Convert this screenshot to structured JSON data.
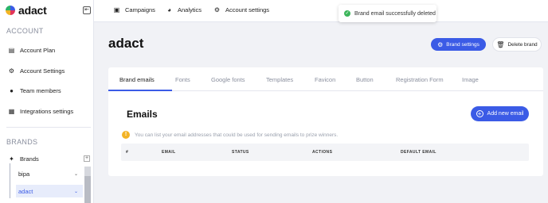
{
  "app": {
    "logo_text": "adact"
  },
  "sidebar": {
    "collapse_icon": "collapse-left-icon",
    "account_title": "ACCOUNT",
    "account_items": [
      {
        "label": "Account Plan",
        "icon": "document-icon"
      },
      {
        "label": "Account Settings",
        "icon": "gear-icon"
      },
      {
        "label": "Team members",
        "icon": "users-icon"
      },
      {
        "label": "Integrations settings",
        "icon": "grid-icon"
      }
    ],
    "brands_title": "BRANDS",
    "brands_root": "Brands",
    "brands": [
      {
        "label": "bipa"
      },
      {
        "label": "adact",
        "active": true
      }
    ]
  },
  "topbar": {
    "items": [
      {
        "label": "Campaigns",
        "icon": "calendar-icon"
      },
      {
        "label": "Analytics",
        "icon": "pie-chart-icon"
      },
      {
        "label": "Account settings",
        "icon": "gear-icon"
      }
    ]
  },
  "toast": {
    "message": "Brand email successfully deleted"
  },
  "page": {
    "title": "adact",
    "brand_settings_label": "Brand settings",
    "delete_brand_label": "Delete brand"
  },
  "tabs": [
    "Brand emails",
    "Fonts",
    "Google fonts",
    "Templates",
    "Favicon",
    "Button",
    "Registration Form",
    "Image"
  ],
  "emails": {
    "title": "Emails",
    "add_label": "Add new email",
    "info": "You can list your email addresses that could be used for sending emails to prize winners.",
    "columns": [
      "#",
      "EMAIL",
      "STATUS",
      "ACTIONS",
      "DEFAULT EMAIL"
    ]
  },
  "colors": {
    "accent": "#3b5be6",
    "success": "#3cb55a",
    "warning": "#f3b325"
  }
}
